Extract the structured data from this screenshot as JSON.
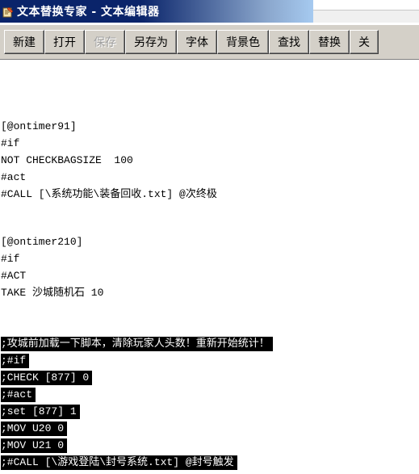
{
  "window": {
    "title": "文本替换专家 - 文本编辑器",
    "icon": "app-icon"
  },
  "toolbar": {
    "buttons": [
      {
        "label": "新建",
        "enabled": true
      },
      {
        "label": "打开",
        "enabled": true
      },
      {
        "label": "保存",
        "enabled": false
      },
      {
        "label": "另存为",
        "enabled": true
      },
      {
        "label": "字体",
        "enabled": true
      },
      {
        "label": "背景色",
        "enabled": true
      },
      {
        "label": "查找",
        "enabled": true
      },
      {
        "label": "替换",
        "enabled": true
      },
      {
        "label": "关",
        "enabled": true
      }
    ]
  },
  "editor": {
    "lines": [
      {
        "text": "[@ontimer91]",
        "selected": false
      },
      {
        "text": "#if",
        "selected": false
      },
      {
        "text": "NOT CHECKBAGSIZE  100",
        "selected": false
      },
      {
        "text": "#act",
        "selected": false
      },
      {
        "text": "#CALL [\\系统功能\\装备回收.txt] @次终极",
        "selected": false
      },
      {
        "text": "[@ontimer210]",
        "selected": false
      },
      {
        "text": "#if",
        "selected": false
      },
      {
        "text": "#ACT",
        "selected": false
      },
      {
        "text": "TAKE 沙城随机石 10",
        "selected": false
      },
      {
        "text": ";攻城前加载一下脚本，清除玩家人头数！重新开始统计！",
        "selected": true
      },
      {
        "text": ";#if",
        "selected": true
      },
      {
        "text": ";CHECK [877] 0",
        "selected": true
      },
      {
        "text": ";#act",
        "selected": true
      },
      {
        "text": ";set [877] 1",
        "selected": true
      },
      {
        "text": ";MOV U20 0",
        "selected": true
      },
      {
        "text": ";MOV U21 0",
        "selected": true
      },
      {
        "text": ";#CALL [\\游戏登陆\\封号系统.txt] @封号触发",
        "selected": true
      }
    ],
    "colors": {
      "text": "#000000",
      "selection_bg": "#000000",
      "selection_fg": "#ffffff"
    }
  },
  "colors": {
    "titlebar_start": "#0a246a",
    "titlebar_end": "#a6caf0",
    "toolbar_bg": "#d4d0c8"
  }
}
